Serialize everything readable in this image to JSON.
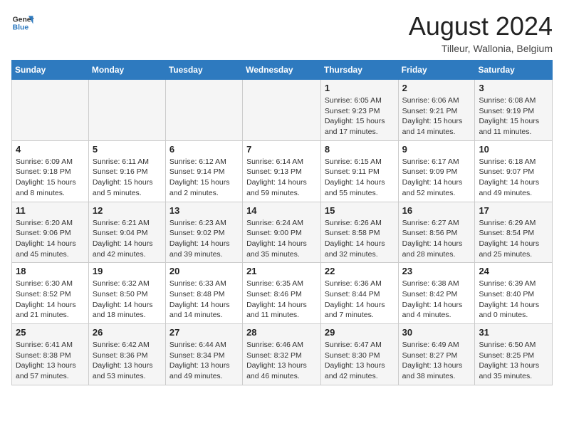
{
  "header": {
    "logo_line1": "General",
    "logo_line2": "Blue",
    "month_title": "August 2024",
    "location": "Tilleur, Wallonia, Belgium"
  },
  "weekdays": [
    "Sunday",
    "Monday",
    "Tuesday",
    "Wednesday",
    "Thursday",
    "Friday",
    "Saturday"
  ],
  "weeks": [
    [
      {
        "day": "",
        "info": ""
      },
      {
        "day": "",
        "info": ""
      },
      {
        "day": "",
        "info": ""
      },
      {
        "day": "",
        "info": ""
      },
      {
        "day": "1",
        "info": "Sunrise: 6:05 AM\nSunset: 9:23 PM\nDaylight: 15 hours and 17 minutes."
      },
      {
        "day": "2",
        "info": "Sunrise: 6:06 AM\nSunset: 9:21 PM\nDaylight: 15 hours and 14 minutes."
      },
      {
        "day": "3",
        "info": "Sunrise: 6:08 AM\nSunset: 9:19 PM\nDaylight: 15 hours and 11 minutes."
      }
    ],
    [
      {
        "day": "4",
        "info": "Sunrise: 6:09 AM\nSunset: 9:18 PM\nDaylight: 15 hours and 8 minutes."
      },
      {
        "day": "5",
        "info": "Sunrise: 6:11 AM\nSunset: 9:16 PM\nDaylight: 15 hours and 5 minutes."
      },
      {
        "day": "6",
        "info": "Sunrise: 6:12 AM\nSunset: 9:14 PM\nDaylight: 15 hours and 2 minutes."
      },
      {
        "day": "7",
        "info": "Sunrise: 6:14 AM\nSunset: 9:13 PM\nDaylight: 14 hours and 59 minutes."
      },
      {
        "day": "8",
        "info": "Sunrise: 6:15 AM\nSunset: 9:11 PM\nDaylight: 14 hours and 55 minutes."
      },
      {
        "day": "9",
        "info": "Sunrise: 6:17 AM\nSunset: 9:09 PM\nDaylight: 14 hours and 52 minutes."
      },
      {
        "day": "10",
        "info": "Sunrise: 6:18 AM\nSunset: 9:07 PM\nDaylight: 14 hours and 49 minutes."
      }
    ],
    [
      {
        "day": "11",
        "info": "Sunrise: 6:20 AM\nSunset: 9:06 PM\nDaylight: 14 hours and 45 minutes."
      },
      {
        "day": "12",
        "info": "Sunrise: 6:21 AM\nSunset: 9:04 PM\nDaylight: 14 hours and 42 minutes."
      },
      {
        "day": "13",
        "info": "Sunrise: 6:23 AM\nSunset: 9:02 PM\nDaylight: 14 hours and 39 minutes."
      },
      {
        "day": "14",
        "info": "Sunrise: 6:24 AM\nSunset: 9:00 PM\nDaylight: 14 hours and 35 minutes."
      },
      {
        "day": "15",
        "info": "Sunrise: 6:26 AM\nSunset: 8:58 PM\nDaylight: 14 hours and 32 minutes."
      },
      {
        "day": "16",
        "info": "Sunrise: 6:27 AM\nSunset: 8:56 PM\nDaylight: 14 hours and 28 minutes."
      },
      {
        "day": "17",
        "info": "Sunrise: 6:29 AM\nSunset: 8:54 PM\nDaylight: 14 hours and 25 minutes."
      }
    ],
    [
      {
        "day": "18",
        "info": "Sunrise: 6:30 AM\nSunset: 8:52 PM\nDaylight: 14 hours and 21 minutes."
      },
      {
        "day": "19",
        "info": "Sunrise: 6:32 AM\nSunset: 8:50 PM\nDaylight: 14 hours and 18 minutes."
      },
      {
        "day": "20",
        "info": "Sunrise: 6:33 AM\nSunset: 8:48 PM\nDaylight: 14 hours and 14 minutes."
      },
      {
        "day": "21",
        "info": "Sunrise: 6:35 AM\nSunset: 8:46 PM\nDaylight: 14 hours and 11 minutes."
      },
      {
        "day": "22",
        "info": "Sunrise: 6:36 AM\nSunset: 8:44 PM\nDaylight: 14 hours and 7 minutes."
      },
      {
        "day": "23",
        "info": "Sunrise: 6:38 AM\nSunset: 8:42 PM\nDaylight: 14 hours and 4 minutes."
      },
      {
        "day": "24",
        "info": "Sunrise: 6:39 AM\nSunset: 8:40 PM\nDaylight: 14 hours and 0 minutes."
      }
    ],
    [
      {
        "day": "25",
        "info": "Sunrise: 6:41 AM\nSunset: 8:38 PM\nDaylight: 13 hours and 57 minutes."
      },
      {
        "day": "26",
        "info": "Sunrise: 6:42 AM\nSunset: 8:36 PM\nDaylight: 13 hours and 53 minutes."
      },
      {
        "day": "27",
        "info": "Sunrise: 6:44 AM\nSunset: 8:34 PM\nDaylight: 13 hours and 49 minutes."
      },
      {
        "day": "28",
        "info": "Sunrise: 6:46 AM\nSunset: 8:32 PM\nDaylight: 13 hours and 46 minutes."
      },
      {
        "day": "29",
        "info": "Sunrise: 6:47 AM\nSunset: 8:30 PM\nDaylight: 13 hours and 42 minutes."
      },
      {
        "day": "30",
        "info": "Sunrise: 6:49 AM\nSunset: 8:27 PM\nDaylight: 13 hours and 38 minutes."
      },
      {
        "day": "31",
        "info": "Sunrise: 6:50 AM\nSunset: 8:25 PM\nDaylight: 13 hours and 35 minutes."
      }
    ]
  ]
}
